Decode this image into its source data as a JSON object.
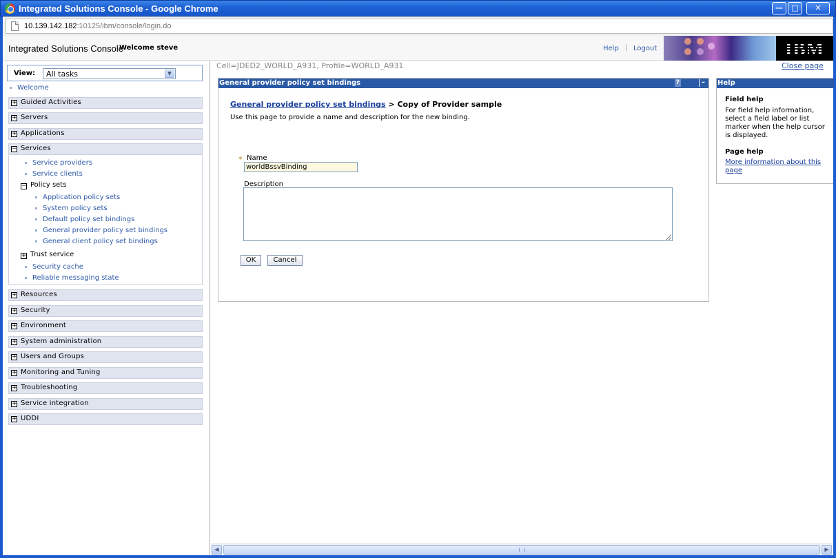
{
  "window": {
    "title": "Integrated Solutions Console - Google Chrome",
    "minimize": "—",
    "maximize": "□",
    "close": "✕"
  },
  "address_bar": {
    "host": "10.139.142.182",
    "rest": ":10125/ibm/console/login.do"
  },
  "header": {
    "product": "Integrated Solutions Console",
    "welcome": "Welcome steve",
    "help_link": "Help",
    "separator": "|",
    "logout_link": "Logout",
    "brand_logo": "IBM"
  },
  "nav": {
    "view_label": "View:",
    "view_value": "All tasks",
    "welcome": "Welcome",
    "categories": {
      "guided": "Guided Activities",
      "servers": "Servers",
      "applications": "Applications",
      "services": "Services",
      "resources": "Resources",
      "security": "Security",
      "environment": "Environment",
      "sysadmin": "System administration",
      "users": "Users and Groups",
      "monitoring": "Monitoring and Tuning",
      "troubleshooting": "Troubleshooting",
      "service_integration": "Service integration",
      "uddi": "UDDI"
    },
    "services_items": {
      "providers": "Service providers",
      "clients": "Service clients",
      "policy_sets": "Policy sets",
      "app_policy_sets": "Application policy sets",
      "sys_policy_sets": "System policy sets",
      "default_bindings": "Default policy set bindings",
      "provider_bindings": "General provider policy set bindings",
      "client_bindings": "General client policy set bindings",
      "trust_service": "Trust service",
      "security_cache": "Security cache",
      "reliable_messaging": "Reliable messaging state"
    }
  },
  "main": {
    "cell_info": "Cell=JDED2_WORLD_A931, Profile=WORLD_A931",
    "close_page": "Close page",
    "panel_title": "General provider policy set bindings",
    "panel_help_icon": "?",
    "panel_min_icon": "–",
    "breadcrumb_link": "General provider policy set bindings",
    "breadcrumb_rest": " > Copy of Provider sample",
    "description": "Use this page to provide a name and description for the new binding.",
    "required_marker": "*",
    "name_label": "Name",
    "name_value": "worldBssvBinding",
    "description_label": "Description",
    "description_value": "",
    "ok_button": "OK",
    "cancel_button": "Cancel"
  },
  "help": {
    "title": "Help",
    "field_help_heading": "Field help",
    "field_help_text": "For field help information, select a field label or list marker when the help cursor is displayed.",
    "page_help_heading": "Page help",
    "page_help_link": "More information about this page"
  },
  "colors": {
    "title_bar": "#1f63d6",
    "panel_header": "#2a5aa6",
    "link": "#2f5aa8",
    "nav_category_bg": "#e0e4ef",
    "name_input_bg": "#fdf8e0"
  }
}
